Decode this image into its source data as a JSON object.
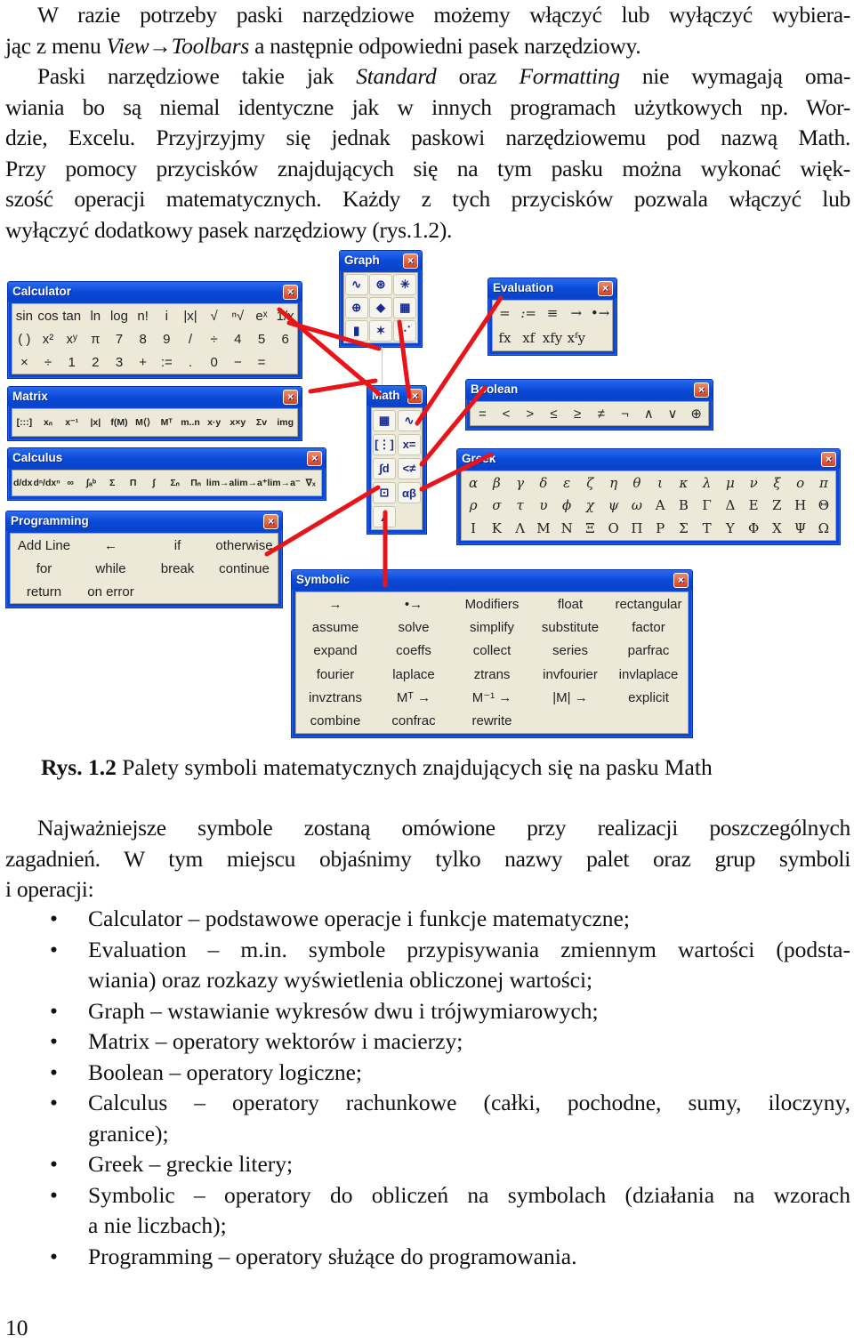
{
  "intro": {
    "p1_line1": "W razie potrzeby paski narzędziowe możemy włączyć lub wyłączyć wybiera-",
    "p1_line2_pre": "jąc z menu ",
    "p1_line2_menu": "View→Toolbars",
    "p1_line2_post": " a następnie odpowiedni pasek narzędziowy.",
    "p2_pre": "Paski narzędziowe takie jak ",
    "p2_standard": "Standard",
    "p2_mid": " oraz ",
    "p2_formatting": "Formatting",
    "p2_post1": " nie wymagają oma-",
    "p2_line2": "wiania bo są niemal identyczne jak w innych programach użytkowych np. Wor-",
    "p2_line3": "dzie, Excelu. Przyjrzyjmy się jednak paskowi narzędziowemu pod nazwą Math.",
    "p2_line4": "Przy pomocy przycisków znajdujących się na tym pasku można wykonać więk-",
    "p2_line5": "szość operacji matematycznych. Każdy z tych przycisków pozwala włączyć lub",
    "p2_line6": "wyłączyć dodatkowy pasek narzędziowy (rys.1.2)."
  },
  "palettes": {
    "calculator": {
      "title": "Calculator",
      "buttons": [
        "sin",
        "cos",
        "tan",
        "ln",
        "log",
        "n!",
        "i",
        "|x|",
        "√",
        "ⁿ√",
        "eˣ",
        "1/x",
        "( )",
        "x²",
        "xʸ",
        "π",
        "7",
        "8",
        "9",
        "/",
        "÷",
        "4",
        "5",
        "6",
        "×",
        "÷",
        "1",
        "2",
        "3",
        "+",
        ":=",
        ".",
        "0",
        "−",
        "="
      ]
    },
    "matrix": {
      "title": "Matrix",
      "buttons": [
        "[:::]",
        "xₙ",
        "x⁻¹",
        "|x|",
        "f(M)",
        "M⟨⟩",
        "Mᵀ",
        "m..n",
        "x·y",
        "x×y",
        "Σv",
        "img"
      ]
    },
    "calculus": {
      "title": "Calculus",
      "buttons": [
        "d/dx",
        "dⁿ/dxⁿ",
        "∞",
        "∫ₐᵇ",
        "Σ",
        "Π",
        "∫",
        "Σₙ",
        "Πₙ",
        "lim→a",
        "lim→a⁺",
        "lim→a⁻",
        "∇ₓ"
      ]
    },
    "programming": {
      "title": "Programming",
      "buttons": [
        "Add Line",
        "←",
        "if",
        "otherwise",
        "for",
        "while",
        "break",
        "continue",
        "return",
        "on error"
      ]
    },
    "graph": {
      "title": "Graph",
      "buttons": [
        "x-y plot",
        "polar plot",
        "surface plot",
        "contour plot",
        "3D bar",
        "3D scatter",
        "vector field",
        "3D plot",
        "trace"
      ]
    },
    "evaluation": {
      "title": "Evaluation",
      "buttons": [
        "=",
        ":=",
        "≡",
        "→",
        "•→",
        "fx",
        "xf",
        "xfy",
        "xᶠy"
      ]
    },
    "math": {
      "title": "Math",
      "buttons": [
        "calculator",
        "graph",
        "matrix",
        "evaluation",
        "calculus",
        "boolean",
        "programming",
        "greek",
        "symbolic"
      ]
    },
    "boolean": {
      "title": "Boolean",
      "buttons": [
        "=",
        "<",
        ">",
        "≤",
        "≥",
        "≠",
        "¬",
        "∧",
        "∨",
        "⊕"
      ]
    },
    "greek": {
      "title": "Greek",
      "buttons": [
        "α",
        "β",
        "γ",
        "δ",
        "ε",
        "ζ",
        "η",
        "θ",
        "ι",
        "κ",
        "λ",
        "μ",
        "ν",
        "ξ",
        "ο",
        "π",
        "ρ",
        "σ",
        "τ",
        "υ",
        "ϕ",
        "χ",
        "ψ",
        "ω",
        "Α",
        "Β",
        "Γ",
        "Δ",
        "Ε",
        "Ζ",
        "Η",
        "Θ",
        "Ι",
        "Κ",
        "Λ",
        "Μ",
        "Ν",
        "Ξ",
        "Ο",
        "Π",
        "Ρ",
        "Σ",
        "Τ",
        "Υ",
        "Φ",
        "Χ",
        "Ψ",
        "Ω"
      ]
    },
    "symbolic": {
      "title": "Symbolic",
      "buttons": [
        "→",
        "•→",
        "Modifiers",
        "float",
        "rectangular",
        "assume",
        "solve",
        "simplify",
        "substitute",
        "factor",
        "expand",
        "coeffs",
        "collect",
        "series",
        "parfrac",
        "fourier",
        "laplace",
        "ztrans",
        "invfourier",
        "invlaplace",
        "invztrans",
        "Mᵀ →",
        "M⁻¹ →",
        "|M| →",
        "explicit",
        "combine",
        "confrac",
        "rewrite"
      ]
    },
    "close_symbol": "×"
  },
  "caption": {
    "label": "Rys. 1.2",
    "text": " Palety symboli matematycznych znajdujących się na pasku Math"
  },
  "section": {
    "line1": "Najważniejsze symbole zostaną omówione przy realizacji poszczególnych",
    "line2": "zagadnień. W tym miejscu objaśnimy tylko nazwy palet oraz grup symboli",
    "line3": "i operacji:"
  },
  "bullets": [
    {
      "l1": "Calculator – podstawowe operacje i funkcje matematyczne;"
    },
    {
      "l1": "Evaluation – m.in. symbole przypisywania zmiennym wartości (podsta-",
      "l2": "wiania) oraz rozkazy wyświetlenia obliczonej wartości;"
    },
    {
      "l1": "Graph – wstawianie wykresów dwu i trójwymiarowych;"
    },
    {
      "l1": "Matrix – operatory wektorów i macierzy;"
    },
    {
      "l1": "Boolean – operatory logiczne;"
    },
    {
      "l1": "Calculus – operatory rachunkowe (całki, pochodne, sumy, iloczyny,",
      "l2": "granice);"
    },
    {
      "l1": "Greek – greckie litery;"
    },
    {
      "l1": "Symbolic – operatory do obliczeń na symbolach (działania na wzorach",
      "l2": "a nie liczbach);"
    },
    {
      "l1": "Programming – operatory służące do programowania."
    }
  ],
  "bullet_symbol": "•",
  "page_number": "10",
  "colors": {
    "title_bar": "#0a46d8",
    "palette_bg": "#ece9d8",
    "connector": "#e8141a",
    "close_btn": "#d8401c"
  }
}
